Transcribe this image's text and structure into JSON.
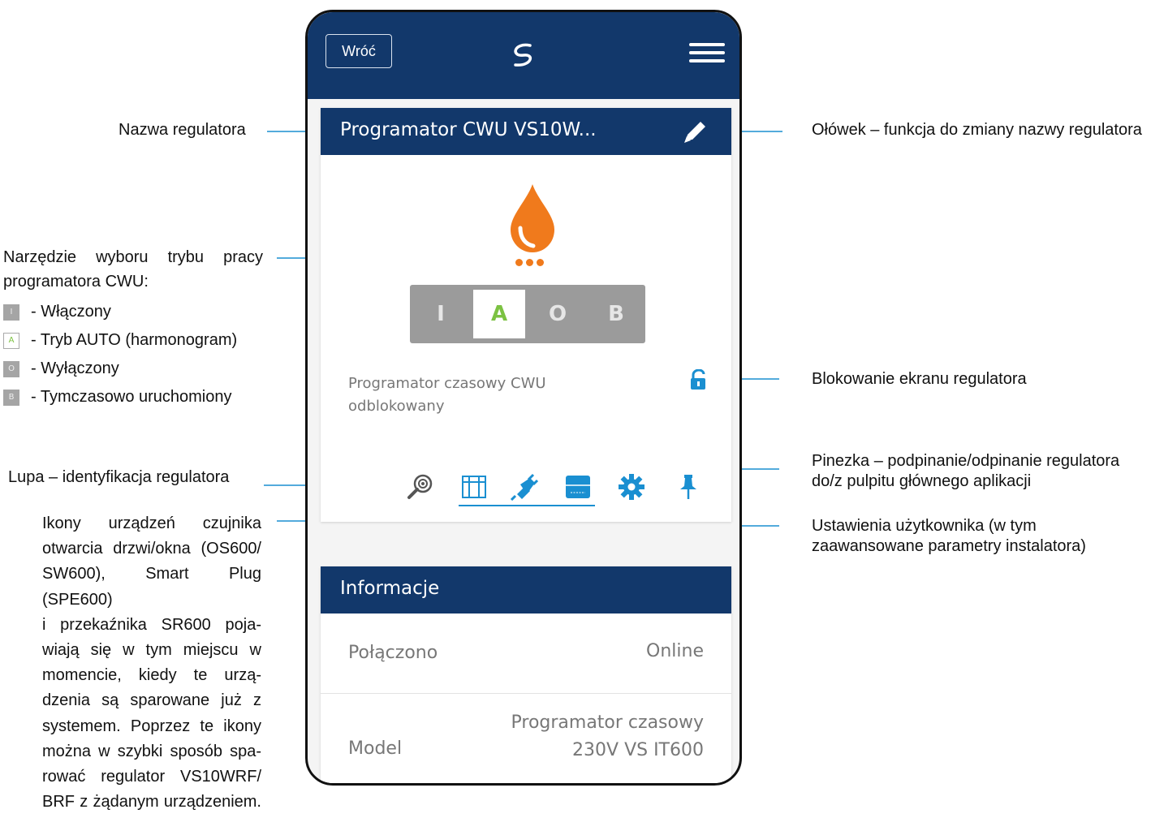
{
  "phone": {
    "back_label": "Wróć",
    "logo_icon": "salus-logo-icon",
    "menu_icon": "hamburger-menu-icon",
    "device_name": "Programator CWU VS10W...",
    "mode_buttons": [
      "I",
      "A",
      "O",
      "B"
    ],
    "selected_mode": "A",
    "lock_status_line1": "Programator czasowy CWU",
    "lock_status_line2": "odblokowany",
    "info_title": "Informacje",
    "info_rows": [
      {
        "label": "Połączono",
        "value": "Online"
      },
      {
        "label": "Model",
        "value_line1": "Programator czasowy",
        "value_line2": "230V VS IT600"
      }
    ],
    "colors": {
      "navy": "#12386b",
      "accent_blue": "#1a8fd1",
      "flame_orange": "#f07a1c",
      "mode_green": "#7cc242"
    }
  },
  "annotations": {
    "name": "Nazwa regulatora",
    "pencil": "Ołówek – funkcja do zmiany nazwy regulatora",
    "mode_tool_line1": "Narzędzie wyboru trybu pracy",
    "mode_tool_line2": "programatora CWU:",
    "legend": [
      {
        "key": "I",
        "text": "- Włączony"
      },
      {
        "key": "A",
        "text": "- Tryb AUTO (harmonogram)"
      },
      {
        "key": "O",
        "text": "- Wyłączony"
      },
      {
        "key": "B",
        "text": "- Tymczasowo uruchomiony"
      }
    ],
    "lock": "Blokowanie ekranu regulatora",
    "magnifier": "Lupa – identyfikacja regulatora",
    "pin_line1": "Pinezka – podpinanie/odpinanie regulatora",
    "pin_line2": "do/z pulpitu głównego aplikacji",
    "settings_line1": "Ustawienia użytkownika (w tym",
    "settings_line2": "zaawansowane parametry instalatora)",
    "devices_paragraph": [
      "Ikony urządzeń czujnika",
      "otwarcia drzwi/okna (OS600/",
      "SW600), Smart Plug (SPE600)",
      "i przekaźnika SR600 poja-",
      "wiają się w tym miejscu w",
      "momencie, kiedy te urzą-",
      "dzenia są sparowane już z",
      "systemem. Poprzez te ikony",
      "można w szybki sposób spa-",
      "rować regulator VS10WRF/",
      "BRF z żądanym urządzeniem."
    ]
  }
}
